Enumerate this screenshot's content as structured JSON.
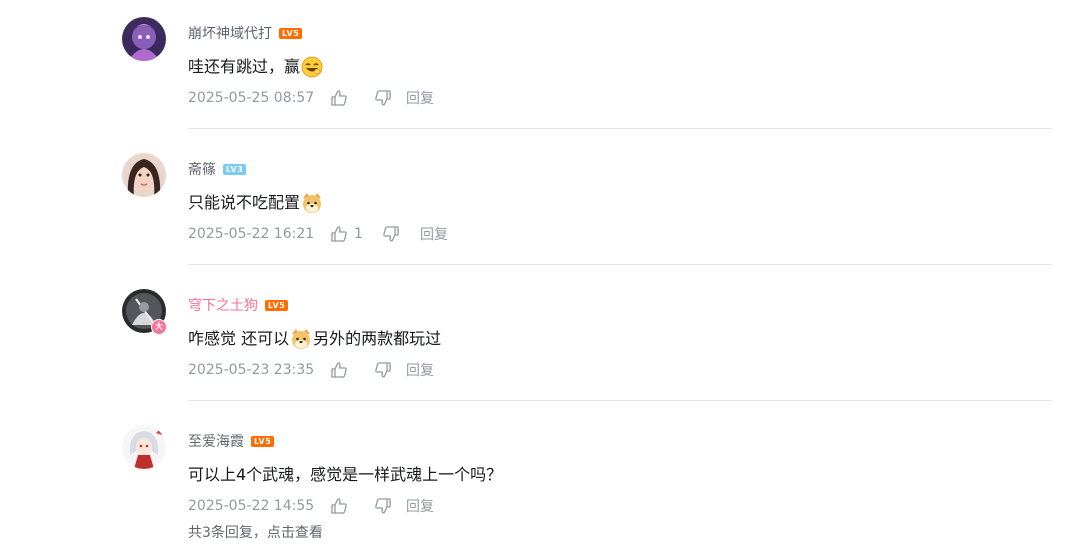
{
  "comments": [
    {
      "username": "崩坏神域代打",
      "level": "LV5",
      "text_before": "哇还有跳过，赢",
      "emoji": "laugh-emoji",
      "text_after": "",
      "time": "2025-05-25 08:57",
      "likes": "",
      "reply_label": "回复"
    },
    {
      "username": "斋篠",
      "level": "LV3",
      "text_before": "只能说不吃配置",
      "emoji": "doge-emoji",
      "text_after": "",
      "time": "2025-05-22 16:21",
      "likes": "1",
      "reply_label": "回复"
    },
    {
      "username": "穹下之土狗",
      "level": "LV5",
      "text_before": "咋感觉 还可以",
      "emoji": "doge-emoji",
      "text_after": "另外的两款都玩过",
      "time": "2025-05-23 23:35",
      "likes": "",
      "reply_label": "回复",
      "badge": "大",
      "username_color": "#fb7299"
    },
    {
      "username": "至爱海霞",
      "level": "LV5",
      "text_before": "可以上4个武魂，感觉是一样武魂上一个吗？",
      "emoji": "",
      "text_after": "",
      "time": "2025-05-22 14:55",
      "likes": "",
      "reply_label": "回复"
    }
  ],
  "sub_reply_hint": "共3条回复，点击查看",
  "colors": {
    "vip_pink": "#fb7299",
    "lv5": "#ff6c00",
    "lv3": "#7bcdef",
    "meta_gray": "#9499a0"
  }
}
